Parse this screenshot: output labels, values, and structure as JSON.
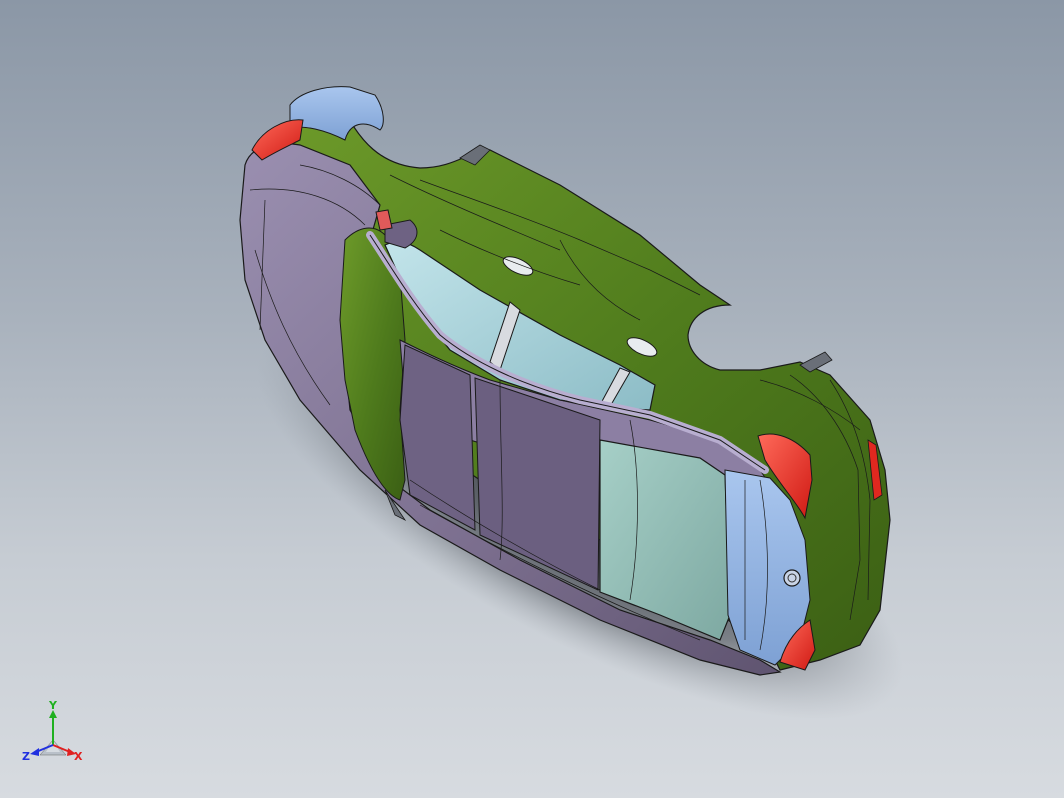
{
  "viewport": {
    "colors": {
      "background_top": "#8b97a6",
      "background_bottom": "#d7dbe0",
      "body_purple": "#7d6f8f",
      "body_green": "#4d7a1c",
      "body_blue": "#8fb2e0",
      "glass": "#a8d0d8",
      "light_red": "#e0281f",
      "edge_line": "#1a1a1a"
    }
  },
  "triad": {
    "x_label": "X",
    "y_label": "Y",
    "z_label": "Z",
    "colors": {
      "x": "#e02020",
      "y": "#20b020",
      "z": "#2030e0"
    }
  }
}
